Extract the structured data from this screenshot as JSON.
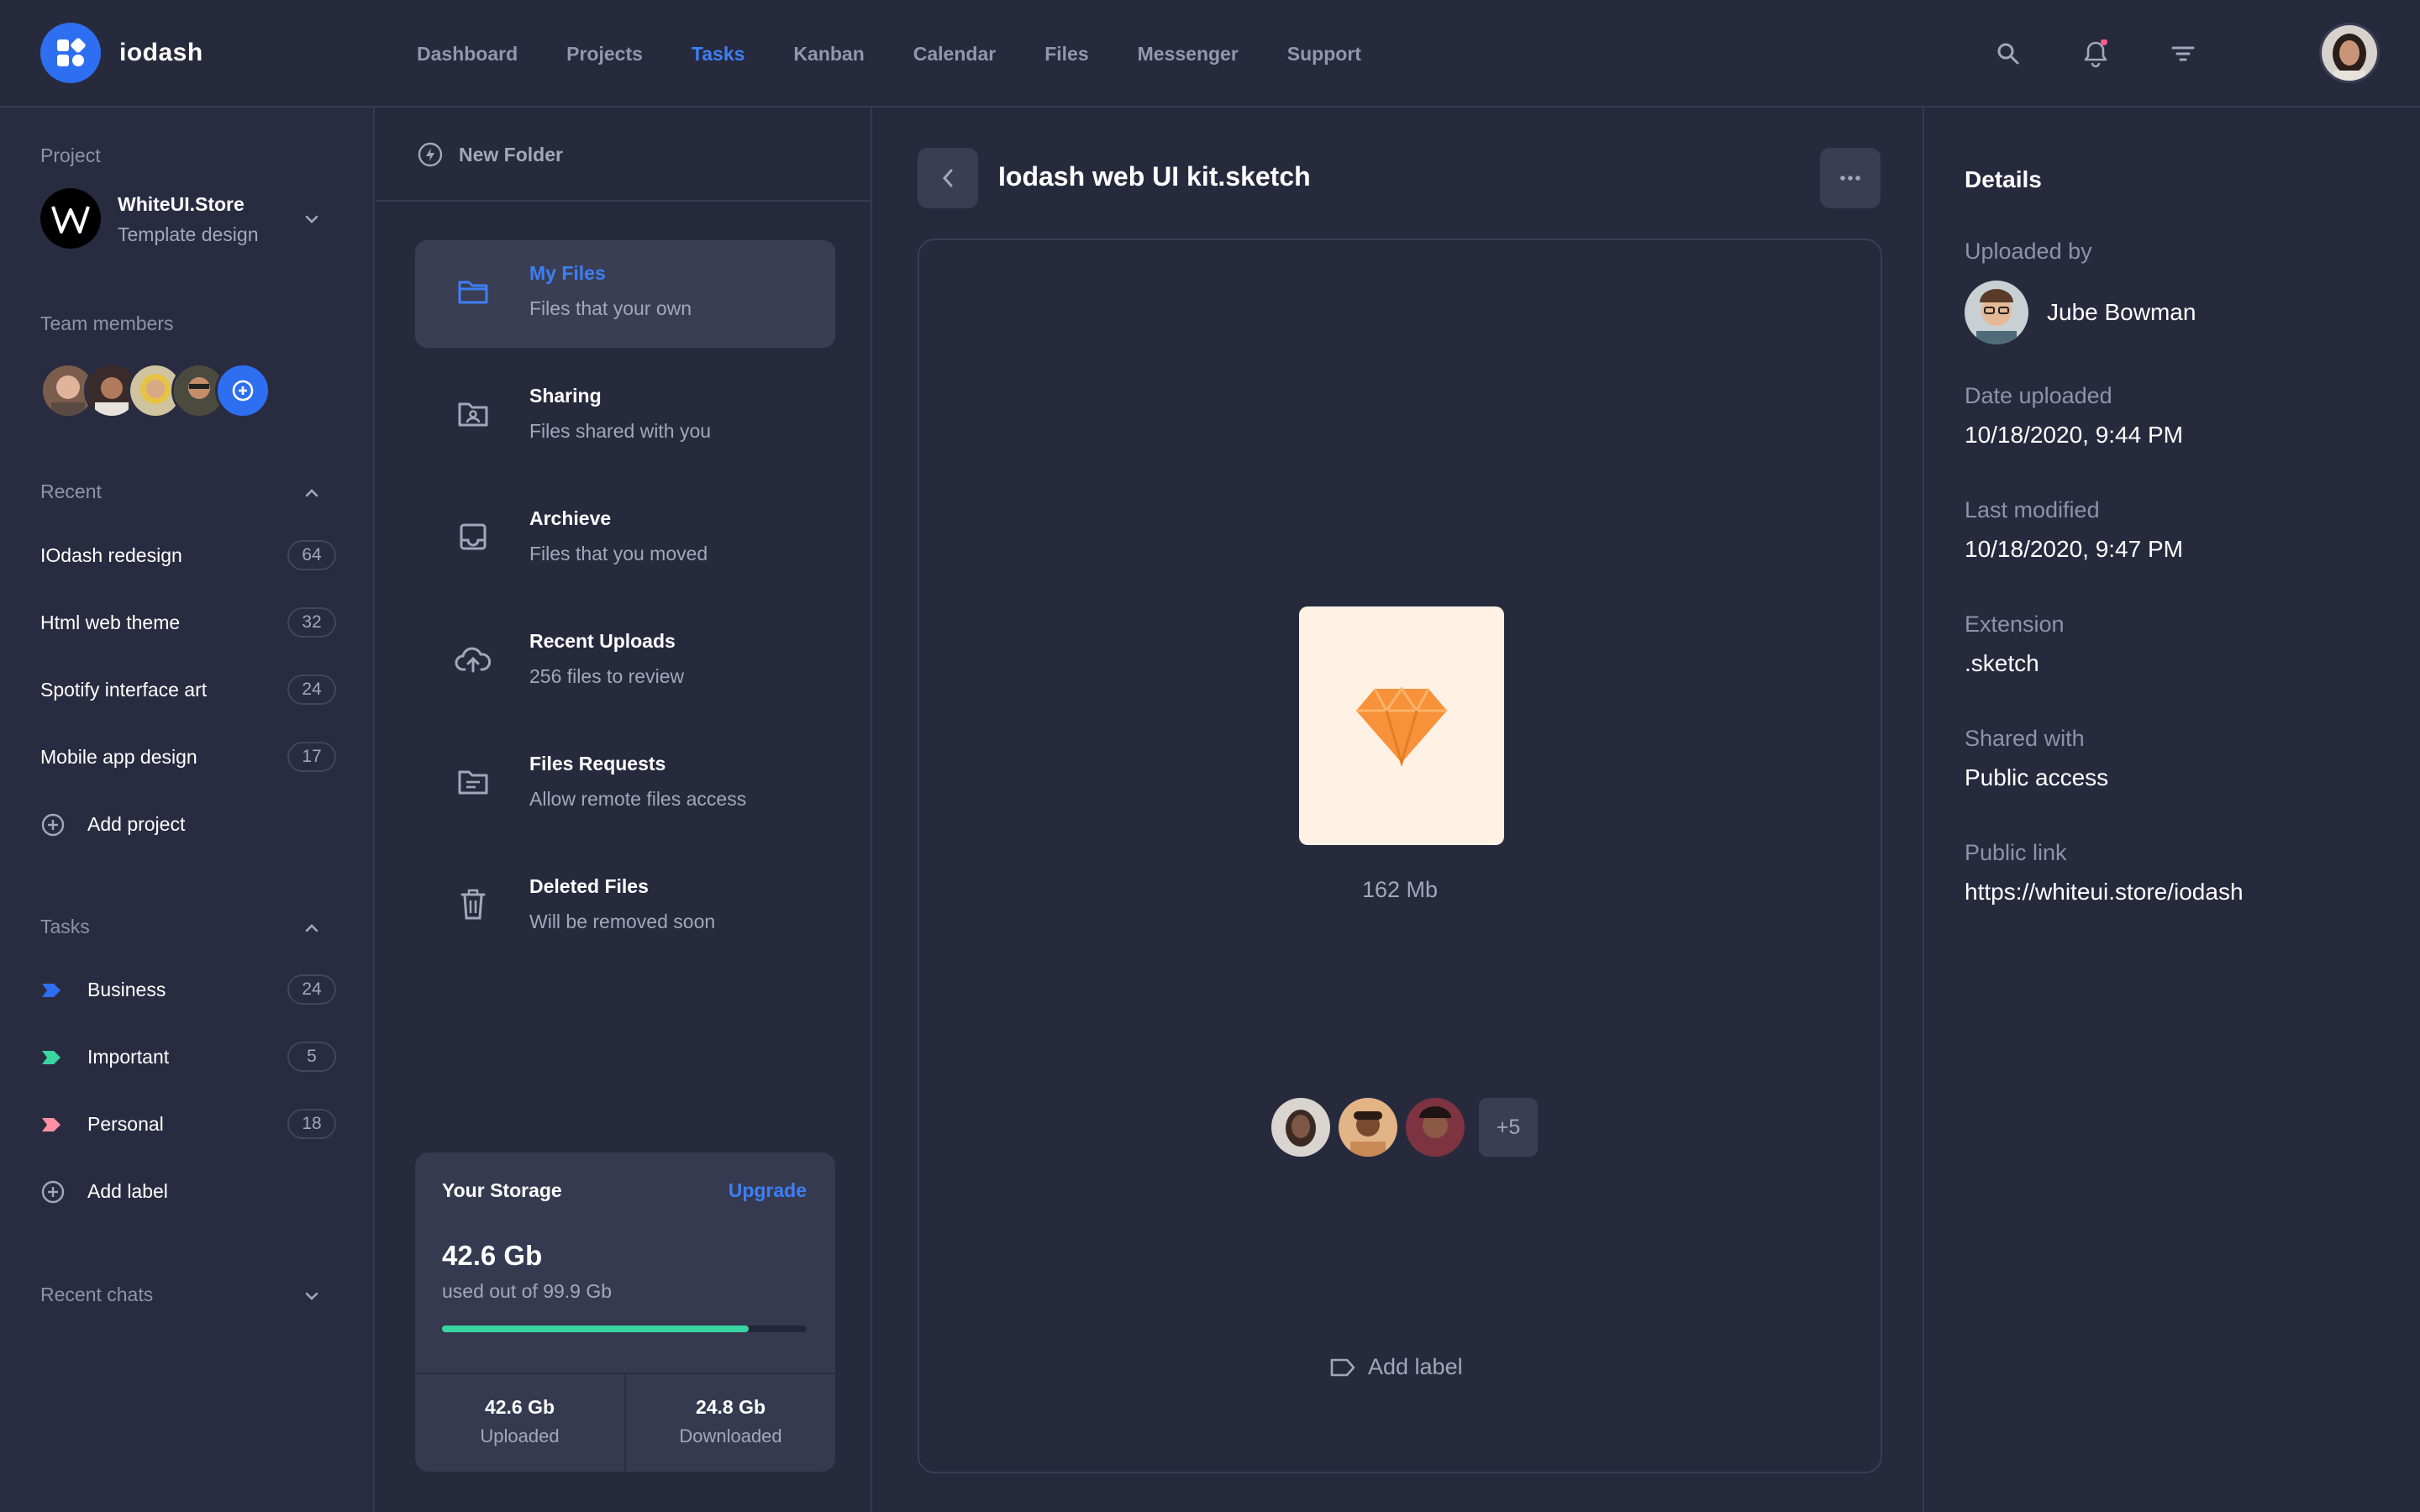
{
  "app": {
    "name": "iodash"
  },
  "nav": [
    {
      "label": "Dashboard",
      "active": false
    },
    {
      "label": "Projects",
      "active": false
    },
    {
      "label": "Tasks",
      "active": true
    },
    {
      "label": "Kanban",
      "active": false
    },
    {
      "label": "Calendar",
      "active": false
    },
    {
      "label": "Files",
      "active": false
    },
    {
      "label": "Messenger",
      "active": false
    },
    {
      "label": "Support",
      "active": false
    }
  ],
  "sidebar": {
    "project_label": "Project",
    "project_name": "WhiteUI.Store",
    "project_sub": "Template design",
    "team_label": "Team members",
    "recent_label": "Recent",
    "recent": [
      {
        "label": "IOdash redesign",
        "count": "64"
      },
      {
        "label": "Html web theme",
        "count": "32"
      },
      {
        "label": "Spotify interface art",
        "count": "24"
      },
      {
        "label": "Mobile app design",
        "count": "17"
      }
    ],
    "add_project": "Add project",
    "tasks_label": "Tasks",
    "tasks": [
      {
        "label": "Business",
        "count": "24",
        "color": "#2e6ff2"
      },
      {
        "label": "Important",
        "count": "5",
        "color": "#3ad6a0"
      },
      {
        "label": "Personal",
        "count": "18",
        "color": "#ff8fa3"
      }
    ],
    "add_label": "Add label",
    "recent_chats": "Recent chats"
  },
  "folders": {
    "new_folder": "New Folder",
    "items": [
      {
        "title": "My Files",
        "sub": "Files that your own",
        "icon": "folder-icon"
      },
      {
        "title": "Sharing",
        "sub": "Files shared with you",
        "icon": "shared-folder-icon"
      },
      {
        "title": "Archieve",
        "sub": "Files that you moved",
        "icon": "archive-icon"
      },
      {
        "title": "Recent Uploads",
        "sub": "256 files to review",
        "icon": "cloud-upload-icon"
      },
      {
        "title": "Files Requests",
        "sub": "Allow remote files access",
        "icon": "file-request-icon"
      },
      {
        "title": "Deleted Files",
        "sub": "Will be removed soon",
        "icon": "trash-icon"
      }
    ],
    "storage": {
      "title": "Your Storage",
      "upgrade": "Upgrade",
      "used": "42.6 Gb",
      "used_of": "used out of 99.9 Gb",
      "percent": 84,
      "uploaded_value": "42.6 Gb",
      "uploaded_label": "Uploaded",
      "downloaded_value": "24.8 Gb",
      "downloaded_label": "Downloaded"
    }
  },
  "file": {
    "title": "Iodash web UI kit.sketch",
    "size": "162 Mb",
    "shared_extra": "+5",
    "add_label": "Add label"
  },
  "details": {
    "title": "Details",
    "uploaded_by_label": "Uploaded by",
    "uploaded_by": "Jube Bowman",
    "date_uploaded_label": "Date uploaded",
    "date_uploaded": "10/18/2020, 9:44 PM",
    "last_modified_label": "Last modified",
    "last_modified": "10/18/2020, 9:47 PM",
    "extension_label": "Extension",
    "extension": ".sketch",
    "shared_with_label": "Shared with",
    "shared_with": "Public access",
    "public_link_label": "Public link",
    "public_link": "https://whiteui.store/iodash"
  },
  "colors": {
    "accent": "#2e6ff2",
    "accent_text": "#3d7ff5",
    "success": "#3ad6a0",
    "sketch": "#f7923a"
  }
}
